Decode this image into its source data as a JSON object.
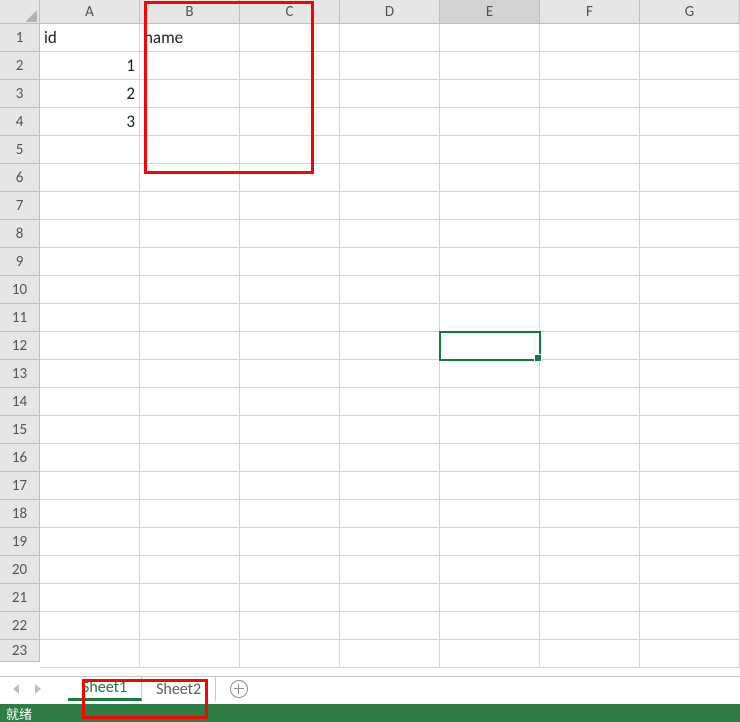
{
  "columns": [
    "A",
    "B",
    "C",
    "D",
    "E",
    "F",
    "G"
  ],
  "rows": [
    "1",
    "2",
    "3",
    "4",
    "5",
    "6",
    "7",
    "8",
    "9",
    "10",
    "11",
    "12",
    "13",
    "14",
    "15",
    "16",
    "17",
    "18",
    "19",
    "20",
    "21",
    "22",
    "23"
  ],
  "cells": {
    "A1": "id",
    "B1": "name",
    "A2": "1",
    "A3": "2",
    "A4": "3"
  },
  "numeric_cells": [
    "A2",
    "A3",
    "A4"
  ],
  "selection": {
    "cell": "E12",
    "active_column": "E"
  },
  "tabs": [
    {
      "name": "Sheet1",
      "active": true
    },
    {
      "name": "Sheet2",
      "active": false
    }
  ],
  "statusbar_text": "就绪",
  "ui": {
    "new_sheet_tooltip": "New sheet"
  },
  "chart_data": {
    "type": "table",
    "headers": [
      "id",
      "name"
    ],
    "rows": [
      {
        "id": 1,
        "name": ""
      },
      {
        "id": 2,
        "name": ""
      },
      {
        "id": 3,
        "name": ""
      }
    ]
  }
}
